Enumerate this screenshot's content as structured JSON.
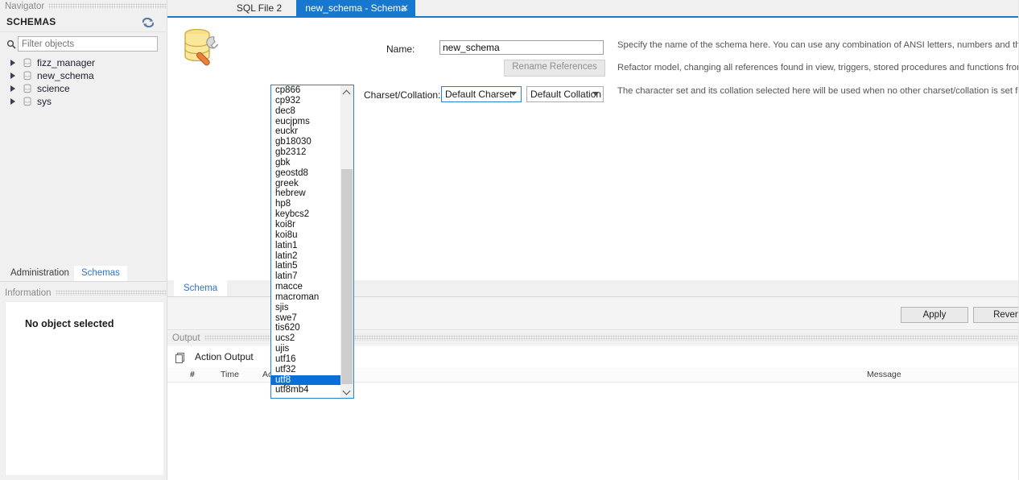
{
  "navigator": {
    "caption": "Navigator",
    "schemas_title": "SCHEMAS",
    "refresh_icon": "refresh-icon",
    "search_icon": "search-icon",
    "filter_placeholder": "Filter objects",
    "filter_value": "",
    "tree": [
      {
        "label": "fizz_manager",
        "icon": "database-icon",
        "expanded": false
      },
      {
        "label": "new_schema",
        "icon": "database-icon",
        "expanded": false
      },
      {
        "label": "science",
        "icon": "database-icon",
        "expanded": false
      },
      {
        "label": "sys",
        "icon": "database-icon",
        "expanded": false
      }
    ],
    "bottom_tabs": [
      {
        "label": "Administration",
        "selected": false
      },
      {
        "label": "Schemas",
        "selected": true
      }
    ],
    "information": {
      "caption": "Information",
      "empty_text": "No object selected"
    }
  },
  "tabbar": {
    "tabs": [
      {
        "label": "SQL File 2",
        "active": false,
        "closable": false
      },
      {
        "label": "new_schema - Schema",
        "active": true,
        "closable": true,
        "close_icon": "close-icon"
      }
    ]
  },
  "editor": {
    "icon": "schema-settings-icon",
    "name_label": "Name:",
    "name_value": "new_schema",
    "rename_button": "Rename References",
    "charset_label": "Charset/Collation:",
    "charset_value": "Default Charset",
    "collation_value": "Default Collation",
    "descriptions": [
      "Specify the name of the schema here. You can use any combination of ANSI letters, numbers and the underscore character for names that don't",
      "Refactor model, changing all references found in view, triggers, stored procedures and functions from the old schema name to the new one.",
      "The character set and its collation selected here will be used when no other charset/collation is set for a database object (it uses the DEFAULT value"
    ],
    "bottom_tab": "Schema",
    "apply_button": "Apply",
    "revert_button": "Revert"
  },
  "charset_dropdown": {
    "open": true,
    "selected": "utf8",
    "scroll_up_icon": "chevron-up-icon",
    "scroll_down_icon": "chevron-down-icon",
    "options": [
      "cp866",
      "cp932",
      "dec8",
      "eucjpms",
      "euckr",
      "gb18030",
      "gb2312",
      "gbk",
      "geostd8",
      "greek",
      "hebrew",
      "hp8",
      "keybcs2",
      "koi8r",
      "koi8u",
      "latin1",
      "latin2",
      "latin5",
      "latin7",
      "macce",
      "macroman",
      "sjis",
      "swe7",
      "tis620",
      "ucs2",
      "ujis",
      "utf16",
      "utf32",
      "utf8",
      "utf8mb4"
    ]
  },
  "output": {
    "caption": "Output",
    "stack_icon": "stack-icon",
    "action_output_label": "Action Output",
    "columns": [
      "#",
      "Time",
      "Action",
      "Message"
    ],
    "rows": []
  },
  "colors": {
    "accent": "#1678ce",
    "selection": "#0a6fd8",
    "link": "#2f72c7",
    "panel": "#f0f0f0"
  }
}
